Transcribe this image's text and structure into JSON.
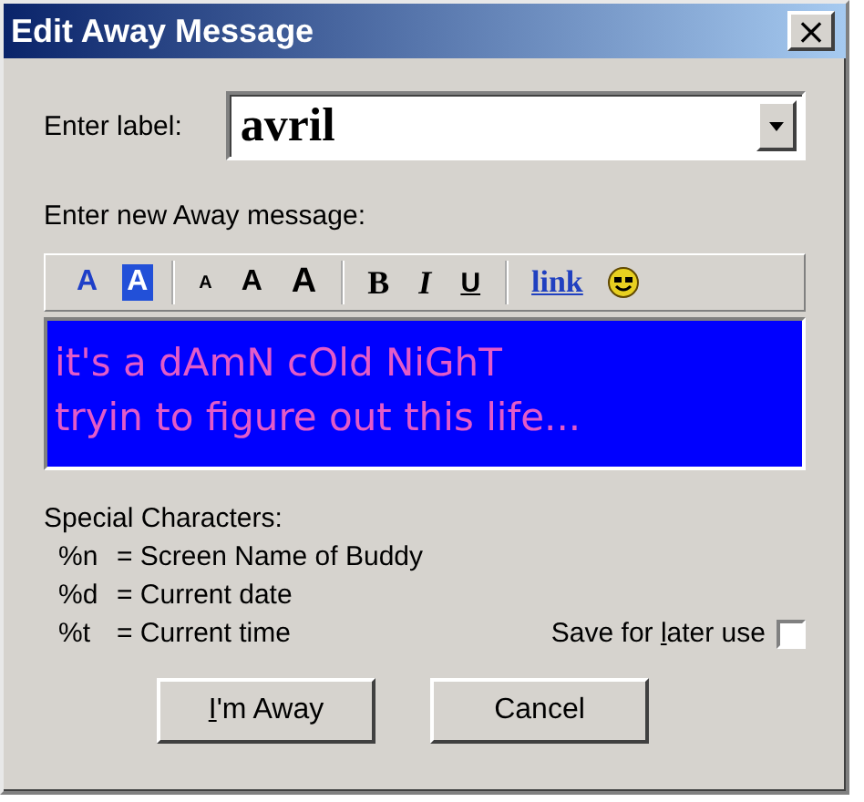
{
  "window": {
    "title": "Edit Away Message",
    "close": "×"
  },
  "label_field": {
    "label": "Enter label:",
    "value": "avril"
  },
  "message_label": "Enter new Away message:",
  "toolbar": [
    {
      "kind": "text-color",
      "label": "A"
    },
    {
      "kind": "back-color",
      "label": "A"
    },
    {
      "kind": "smaller",
      "label": "A"
    },
    {
      "kind": "normal",
      "label": "A"
    },
    {
      "kind": "larger",
      "label": "A"
    },
    {
      "kind": "bold",
      "label": "B"
    },
    {
      "kind": "italic",
      "label": "I"
    },
    {
      "kind": "underline",
      "label": "U"
    },
    {
      "kind": "link",
      "label": "link"
    },
    {
      "kind": "smiley"
    }
  ],
  "message": {
    "lines": [
      "it's a dAmN cOld NiGhT",
      "tryin to figure out this life..."
    ]
  },
  "special_characters": {
    "title": "Special Characters:",
    "items": [
      {
        "code": "%n",
        "meaning": "= Screen Name of Buddy"
      },
      {
        "code": "%d",
        "meaning": "= Current date"
      },
      {
        "code": "%t",
        "meaning": "= Current time"
      }
    ]
  },
  "save_option": {
    "label": "Save for later use",
    "checked": false
  },
  "buttons": [
    {
      "label": "I'm Away"
    },
    {
      "label": "Cancel"
    }
  ]
}
